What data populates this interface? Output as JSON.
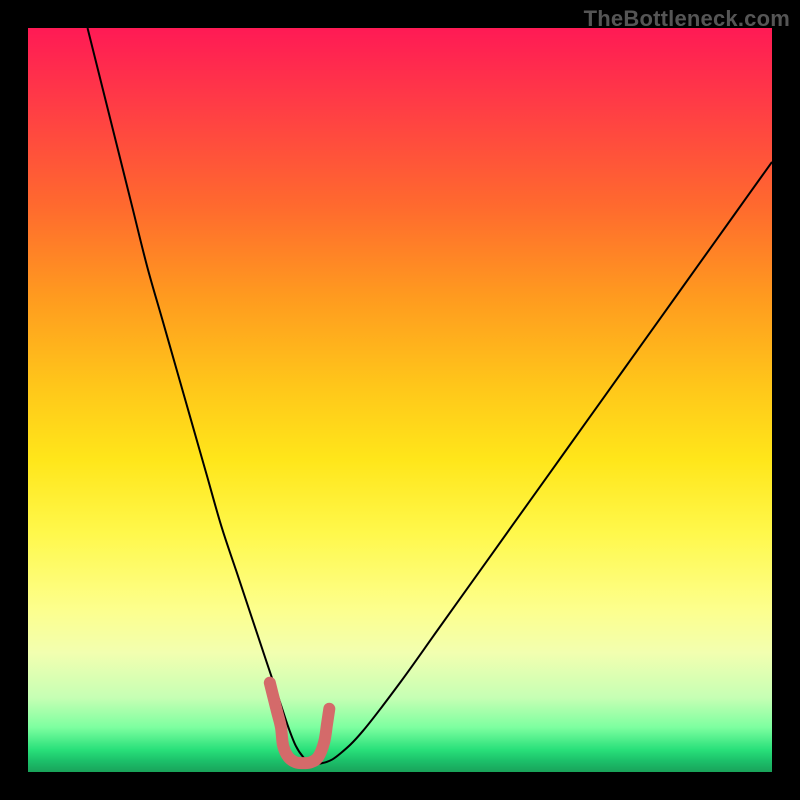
{
  "watermark": "TheBottleneck.com",
  "chart_data": {
    "type": "line",
    "title": "",
    "xlabel": "",
    "ylabel": "",
    "xlim": [
      0,
      100
    ],
    "ylim": [
      0,
      100
    ],
    "grid": false,
    "legend": false,
    "series": [
      {
        "name": "curve",
        "x": [
          8,
          10,
          12,
          14,
          16,
          18,
          20,
          22,
          24,
          26,
          28,
          30,
          32,
          33,
          34,
          35,
          36,
          37,
          38,
          40,
          42,
          45,
          50,
          55,
          60,
          65,
          70,
          75,
          80,
          85,
          90,
          95,
          100
        ],
        "y": [
          100,
          92,
          84,
          76,
          68,
          61,
          54,
          47,
          40,
          33,
          27,
          21,
          15,
          12,
          9,
          6,
          3.5,
          2,
          1.2,
          1.3,
          2.5,
          5.5,
          12,
          19,
          26,
          33,
          40,
          47,
          54,
          61,
          68,
          75,
          82
        ],
        "stroke": "#000000",
        "stroke_width": 2
      },
      {
        "name": "highlight",
        "x": [
          32.5,
          33.0,
          33.5,
          34.0,
          34.3,
          35.0,
          36.0,
          37.0,
          38.0,
          39.0,
          39.8,
          40.2,
          40.5
        ],
        "y": [
          12.0,
          10.0,
          8.0,
          6.0,
          3.5,
          2.0,
          1.3,
          1.2,
          1.3,
          2.0,
          4.0,
          6.5,
          8.5
        ],
        "stroke": "#d46a6a",
        "stroke_width": 12,
        "linecap": "round"
      }
    ],
    "annotations": []
  }
}
